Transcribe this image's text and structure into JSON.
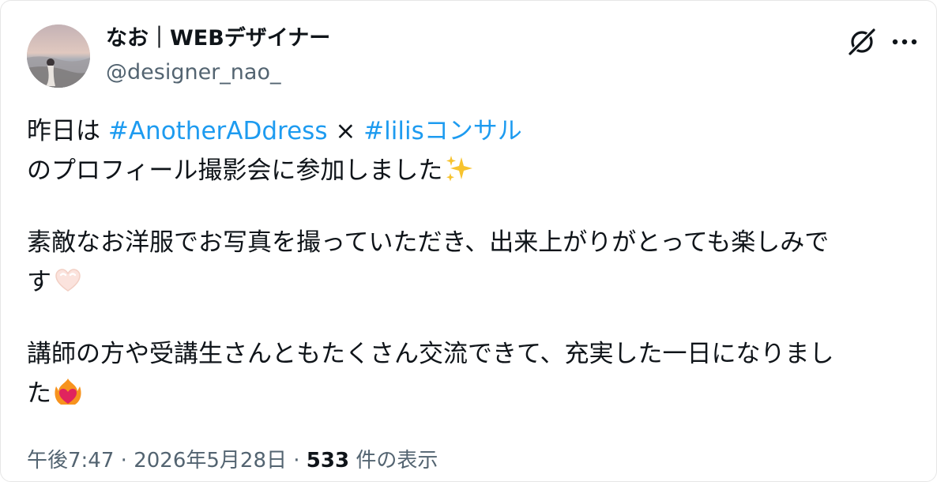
{
  "author": {
    "display_name": "なお｜WEBデザイナー",
    "handle": "@designer_nao_"
  },
  "header": {
    "grok_icon": "grok-icon",
    "more_icon": "more-options-icon",
    "more_label": "···"
  },
  "post": {
    "line1": {
      "prefix": "昨日は ",
      "hashtag1": "#AnotherADdress",
      "separator": " × ",
      "hashtag2": "#lilisコンサル"
    },
    "line2": "のプロフィール撮影会に参加しました",
    "line3": "素敵なお洋服でお写真を撮っていただき、出来上がりがとっても楽しみで",
    "line4": "す",
    "line5": "講師の方や受講生さんともたくさん交流できて、充実した一日になりまし",
    "line6": "た",
    "emojis": [
      "sparkles-emoji",
      "heart-hands-emoji",
      "heart-on-fire-emoji"
    ]
  },
  "meta": {
    "time": "午後7:47",
    "dot1": " · ",
    "date": "2026年5月28日",
    "dot2": " · ",
    "views_count": "533",
    "views_label": " 件の表示"
  },
  "colors": {
    "text": "#0f1419",
    "secondary": "#536471",
    "link": "#1d9bf0",
    "border": "#e6e6e6"
  }
}
